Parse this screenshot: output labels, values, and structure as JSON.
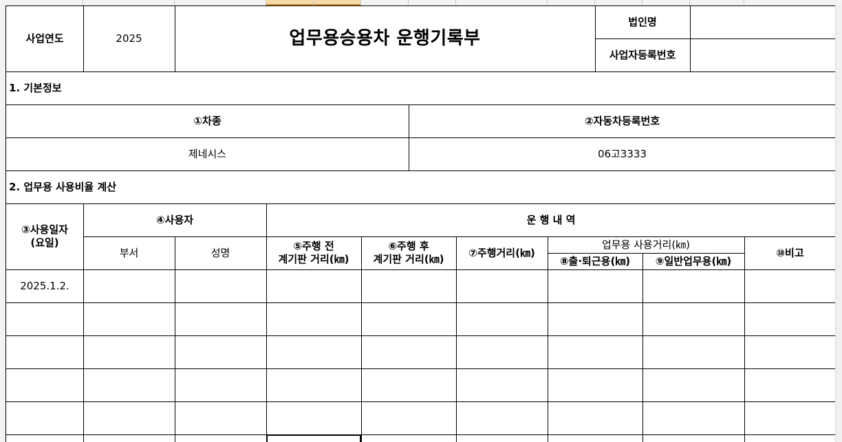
{
  "header": {
    "year_label": "사업연도",
    "year_value": "2025",
    "title": "업무용승용차 운행기록부",
    "corp_label": "법인명",
    "corp_value": "",
    "regno_label": "사업자등록번호",
    "regno_value": ""
  },
  "section1": {
    "title": "1. 기본정보",
    "car_type_label": "①차종",
    "car_reg_label": "②자동차등록번호",
    "car_type_value": "제네시스",
    "car_reg_value": "06고3333"
  },
  "section2": {
    "title": "2. 업무용 사용비율 계산",
    "use_date_label": "③사용일자\n(요일)",
    "user_label": "④사용자",
    "operation_label": "운 행 내 역",
    "dept_label": "부서",
    "name_label": "성명",
    "before_label": "⑤주행 전\n계기판 거리(㎞)",
    "after_label": "⑥주행 후\n계기판 거리(㎞)",
    "distance_label": "⑦주행거리(㎞)",
    "business_group_label": "업무용 사용거리(㎞)",
    "commute_label": "⑧출·퇴근용(㎞)",
    "general_label": "⑨일반업무용(㎞)",
    "note_label": "⑩비고",
    "rows": [
      {
        "date": "2025.1.2."
      },
      {
        "date": ""
      },
      {
        "date": ""
      },
      {
        "date": ""
      },
      {
        "date": ""
      }
    ]
  }
}
